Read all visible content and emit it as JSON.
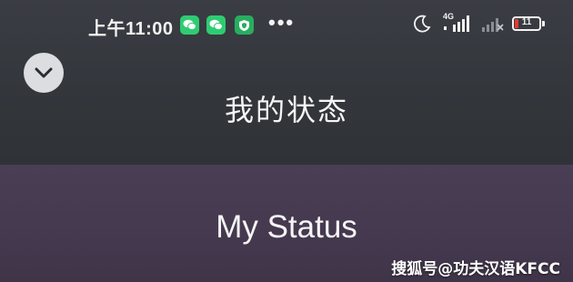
{
  "status_bar": {
    "time": "上午11:00",
    "network_label": "4G",
    "battery_level": "11",
    "more": "•••"
  },
  "header": {
    "back_icon": "chevron-down-icon"
  },
  "main": {
    "title_cn": "我的状态",
    "title_en": "My Status"
  },
  "watermark": {
    "text": "搜狐号@功夫汉语KFCC"
  },
  "colors": {
    "top_bg": "#33373c",
    "bottom_bg": "#45394f",
    "app_icon_green": "#2ecc71",
    "battery_low": "#e53935"
  }
}
